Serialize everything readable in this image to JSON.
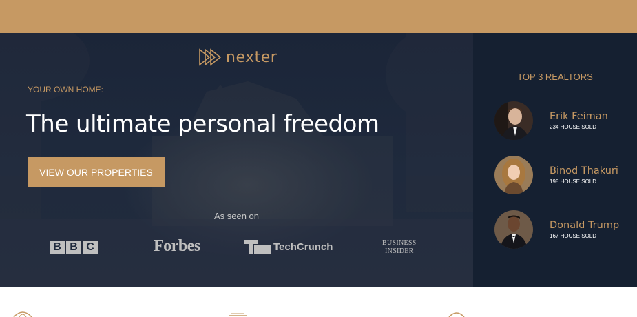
{
  "brand": {
    "logo_text": "nexter"
  },
  "hero": {
    "kicker": "YOUR OWN HOME:",
    "headline": "The ultimate personal freedom",
    "cta_label": "VIEW OUR PROPERTIES",
    "seen_on": "As seen on",
    "media": {
      "bbc": [
        "B",
        "B",
        "C"
      ],
      "forbes": "Forbes",
      "techcrunch": "TechCrunch",
      "business_insider_line1": "BUSINESS",
      "business_insider_line2": "INSIDER"
    }
  },
  "realtors": {
    "title": "TOP 3 REALTORS",
    "items": [
      {
        "name": "Erik Feiman",
        "sold": "234 HOUSE SOLD"
      },
      {
        "name": "Binod Thakuri",
        "sold": "198 HOUSE SOLD"
      },
      {
        "name": "Donald Trump",
        "sold": "167 HOUSE SOLD"
      }
    ]
  },
  "colors": {
    "accent": "#c69963",
    "hero_bg": "#1f2a3d",
    "sidebar_bg": "#152031",
    "white": "#ffffff",
    "muted": "#bfbfbf"
  },
  "icons": {
    "logo": "play-arrows-logo-icon",
    "feature_icons": [
      "globe-icon",
      "house-icon",
      "compass-icon"
    ]
  }
}
